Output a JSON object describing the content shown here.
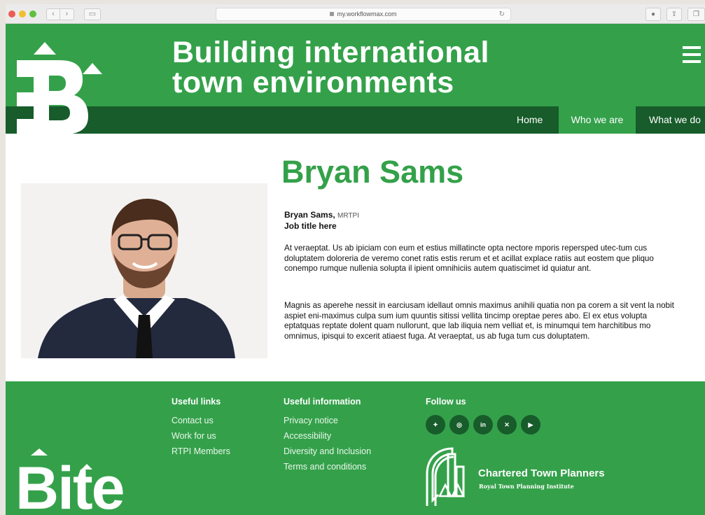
{
  "browser": {
    "url": "my.workflowmax.com"
  },
  "header": {
    "headline_line1": "Building international",
    "headline_line2": "town environments",
    "nav": [
      "Home",
      "Who we are",
      "What we do"
    ]
  },
  "profile": {
    "name_heading": "Bryan Sams",
    "name": "Bryan Sams,",
    "credentials": "MRTPI",
    "job_title": "Job title here",
    "paragraph1": "At veraeptat. Us ab ipiciam con eum et estius millatincte opta nectore mporis repersped utec-tum cus doluptatem doloreria de veremo conet ratis estis rerum et et acillat explace ratiis aut eostem que pliquo conempo rumque nullenia solupta il ipient omnihiciis autem quatiscimet id quiatur ant.",
    "paragraph2": "Magnis as aperehe nessit in earciusam idellaut omnis maximus anihili quatia non pa corem a sit vent la nobit aspiet eni-maximus culpa sum ium quuntis sitissi vellita tincimp oreptae peres abo. El ex etus volupta eptatquas reptate dolent quam nullorunt, que lab iliquia nem velliat et, is minumqui tem harchitibus mo omnimus, ipisqui to excerit atiaest fuga. At veraeptat, us ab fuga tum cus doluptatem."
  },
  "footer": {
    "useful_links": {
      "title": "Useful links",
      "items": [
        "Contact us",
        "Work for us",
        "RTPI Members"
      ]
    },
    "useful_information": {
      "title": "Useful information",
      "items": [
        "Privacy notice",
        "Accessibility",
        "Diversity and Inclusion",
        "Terms and conditions"
      ]
    },
    "follow_us": {
      "title": "Follow us",
      "icons": [
        "bluesky-icon",
        "instagram-icon",
        "linkedin-icon",
        "x-icon",
        "youtube-icon"
      ]
    },
    "rtpi": {
      "name": "Chartered Town Planners",
      "subtitle": "Royal Town Planning Institute"
    },
    "logo_text": "Bite"
  },
  "colors": {
    "brand_green": "#34a14a",
    "dark_green": "#175c2a"
  }
}
